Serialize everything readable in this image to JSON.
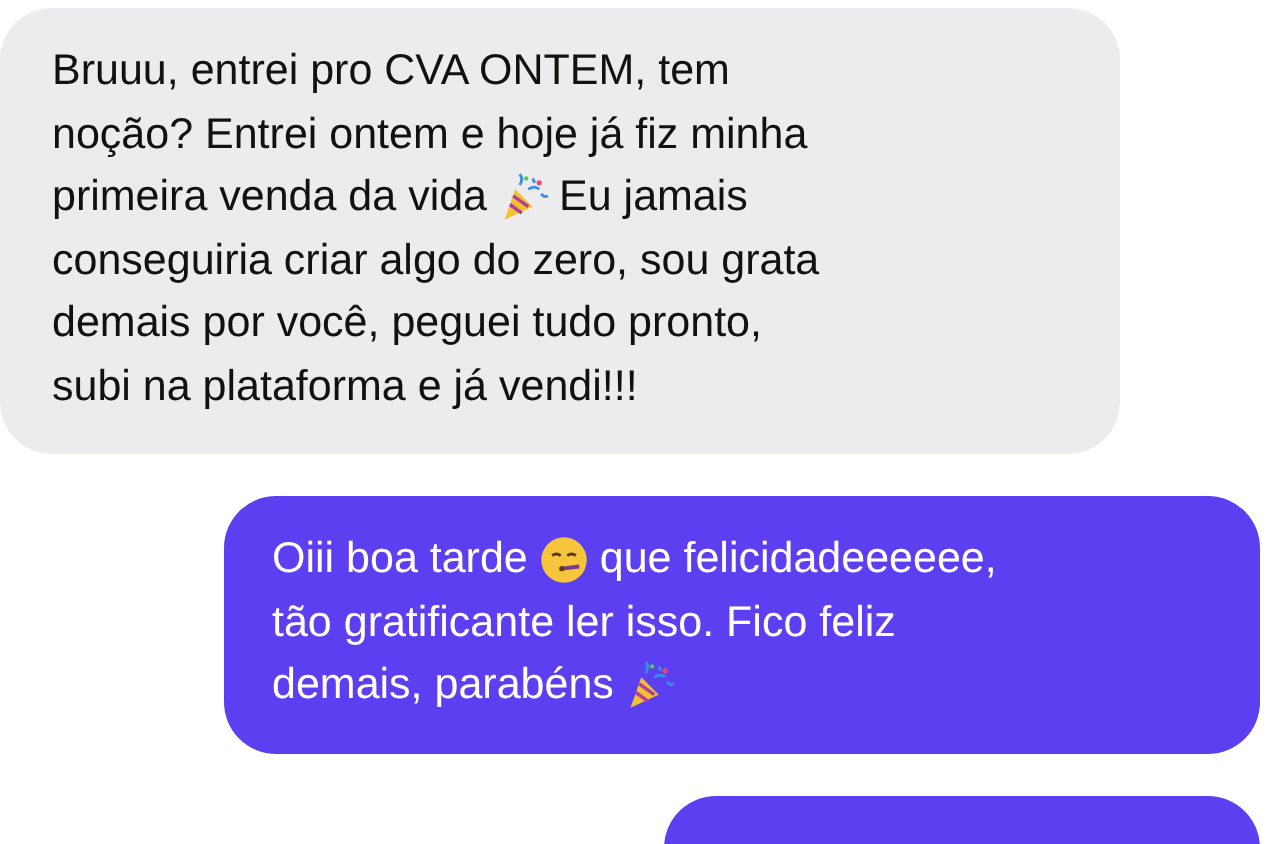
{
  "messages": [
    {
      "kind": "received",
      "lines": [
        [
          {
            "kind": "text",
            "text": "Bruuu, entrei pro CVA ONTEM, tem"
          }
        ],
        [
          {
            "kind": "text",
            "text": "noção? Entrei ontem e hoje já fiz minha"
          }
        ],
        [
          {
            "kind": "text",
            "text": "primeira venda da vida"
          },
          {
            "kind": "popper"
          },
          {
            "kind": "text",
            "text": "Eu jamais"
          }
        ],
        [
          {
            "kind": "text",
            "text": "conseguiria criar algo do zero, sou grata"
          }
        ],
        [
          {
            "kind": "text",
            "text": "demais por você, peguei tudo pronto,"
          }
        ],
        [
          {
            "kind": "text",
            "text": "subi na plataforma e já vendi!!!"
          }
        ]
      ]
    },
    {
      "kind": "sent",
      "lines": [
        [
          {
            "kind": "text",
            "text": "Oiii boa tarde"
          },
          {
            "kind": "face"
          },
          {
            "kind": "text",
            "text": "que felicidadeeeeee,"
          }
        ],
        [
          {
            "kind": "text",
            "text": "tão gratificante ler isso. Fico feliz"
          }
        ],
        [
          {
            "kind": "text",
            "text": "demais, parabéns"
          },
          {
            "kind": "popper"
          }
        ]
      ]
    },
    {
      "kind": "sent"
    }
  ]
}
